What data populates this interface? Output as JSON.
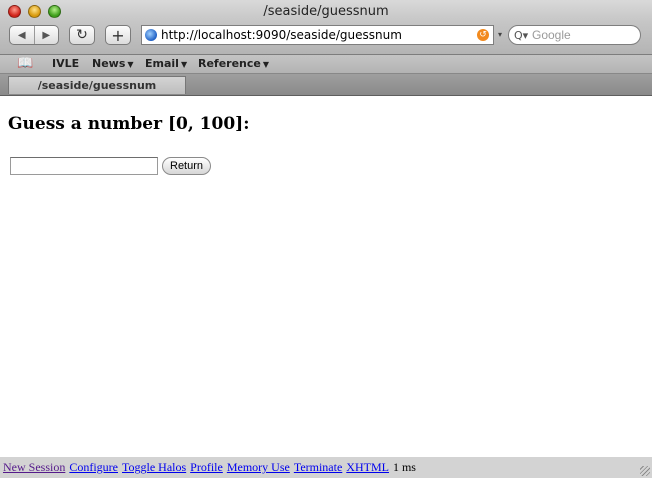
{
  "window": {
    "title": "/seaside/guessnum"
  },
  "toolbar": {
    "back_symbol": "◀",
    "forward_symbol": "▶",
    "reload_symbol": "↻",
    "add_symbol": "+",
    "url": "http://localhost:9090/seaside/guessnum",
    "search_placeholder": "Google",
    "search_symbol": "Q▾"
  },
  "bookmarks": {
    "items": [
      {
        "label": "IVLE"
      },
      {
        "label": "News"
      },
      {
        "label": "Email"
      },
      {
        "label": "Reference"
      }
    ]
  },
  "tabs": [
    {
      "label": "/seaside/guessnum"
    }
  ],
  "page": {
    "heading": "Guess a number [0, 100]:",
    "input_value": "",
    "return_label": "Return"
  },
  "seaside_toolbar": {
    "links": [
      "New Session",
      "Configure",
      "Toggle Halos",
      "Profile",
      "Memory Use",
      "Terminate",
      "XHTML"
    ],
    "timing": "1 ms"
  },
  "icons": {
    "bookmarks": "book-icon",
    "url": "globe-icon",
    "snapback": "snapback-icon",
    "search": "magnifier-icon"
  }
}
